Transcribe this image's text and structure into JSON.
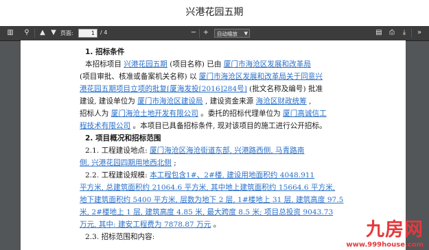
{
  "page": {
    "title": "兴港花园五期"
  },
  "toolbar": {
    "page_label": "页面:",
    "page_current": "1",
    "page_total": "/ 4",
    "zoom_value": "自动缩放"
  },
  "document": {
    "lines": [
      {
        "segs": [
          {
            "t": "1. 招标条件"
          }
        ],
        "cls": "heading",
        "indent": 1
      },
      {
        "segs": [
          {
            "t": "本招标项目 "
          },
          {
            "t": "兴港花园五期",
            "u": true
          },
          {
            "t": " (项目名称) 已由 "
          },
          {
            "t": "厦门市海沧区发展和改革局",
            "u": true
          }
        ],
        "indent": 1
      },
      {
        "segs": [
          {
            "t": "(项目审批、核准或备案机关名称) 以 "
          },
          {
            "t": "厦门市海沧区发展和改革局关于同意兴",
            "u": true
          }
        ],
        "indent": 0
      },
      {
        "segs": [
          {
            "t": "港花园五期项目立项的批复[厦海发投[2016]284号]",
            "u": true
          },
          {
            "t": " (批文名称及编号) 批准"
          }
        ],
        "indent": 0
      },
      {
        "segs": [
          {
            "t": "建设, 建设单位为 "
          },
          {
            "t": "厦门市海沧区建设局",
            "u": true
          },
          {
            "t": " , 建设资金来源 "
          },
          {
            "t": "海沧区财政统筹",
            "u": true
          },
          {
            "t": " ,"
          }
        ],
        "indent": 0
      },
      {
        "segs": [
          {
            "t": "招标人为 "
          },
          {
            "t": "厦门海沧土地开发有限公司",
            "u": true
          },
          {
            "t": " 。委托的招标代理单位为 "
          },
          {
            "t": "厦门高诚信工",
            "u": true
          }
        ],
        "indent": 0
      },
      {
        "segs": [
          {
            "t": "程技术有限公司",
            "u": true
          },
          {
            "t": " 。本项目已具备招标条件, 现对该项目的施工进行公开招标。"
          }
        ],
        "indent": 0
      },
      {
        "segs": [
          {
            "t": "2. 项目概况和招标范围"
          }
        ],
        "cls": "heading",
        "indent": 1
      },
      {
        "segs": [
          {
            "t": "2.1.    工程建设地点: "
          },
          {
            "t": "厦门海沧区海沧街道东部, 兴港路西侧, 马青路南",
            "u": true
          }
        ],
        "indent": 1
      },
      {
        "segs": [
          {
            "t": "侧, 兴港花园四期用地西北侧",
            "u": true
          },
          {
            "t": " ;"
          }
        ],
        "indent": 0
      },
      {
        "segs": [
          {
            "t": "2.2.    工程建设规模: "
          },
          {
            "t": "本工程包含1#、2#楼, 建设用地面积约 4048.911",
            "u": true
          }
        ],
        "indent": 1
      },
      {
        "segs": [
          {
            "t": "平方米, 总建筑面积约 21064.6 平方米, 其中地上建筑面积约 15664.6 平方米,",
            "u": true
          }
        ],
        "indent": 0
      },
      {
        "segs": [
          {
            "t": "地下建筑面积约 5400 平方米, 层数为地下 2 层, 1#楼地上 31 层, 建筑高度 97.5",
            "u": true
          }
        ],
        "indent": 0
      },
      {
        "segs": [
          {
            "t": "米, 2#楼地上 1 层, 建筑高度 4.85 米, 最大跨度 8.5 米; 项目总投资 9043.73",
            "u": true
          }
        ],
        "indent": 0
      },
      {
        "segs": [
          {
            "t": "万元, 其中: 建安工程费为 7878.87 万元",
            "u": true
          },
          {
            "t": " 。"
          }
        ],
        "indent": 0
      },
      {
        "segs": [
          {
            "t": "2.3.    招标范围和内容:"
          }
        ],
        "indent": 1
      }
    ]
  },
  "watermark": {
    "logo_text": "九房网",
    "url": "www.999house.com"
  },
  "colors": {
    "link": "#2a6fc9",
    "viewer_bg": "#525659",
    "toolbar_bg": "#3c3c3c",
    "watermark": "#e4393c"
  },
  "icons": {
    "sidebar": "sidebar-toggle-icon",
    "search": "search-icon",
    "prev": "previous-page-icon",
    "next": "next-page-icon",
    "zoom_out": "zoom-out-icon",
    "zoom_in": "zoom-in-icon",
    "open": "open-file-icon",
    "print": "print-icon",
    "download": "download-icon",
    "tools": "tools-icon"
  }
}
